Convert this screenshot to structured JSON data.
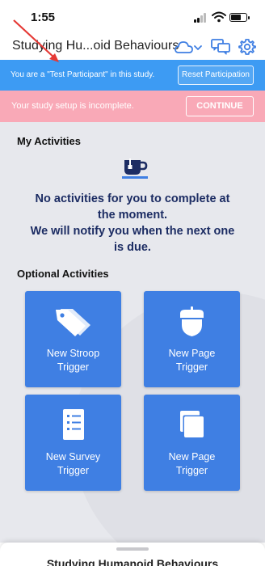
{
  "status_bar": {
    "time": "1:55",
    "battery_level": 0.7
  },
  "header": {
    "title": "Studying Hu...oid Behaviours",
    "icons": [
      "cloud-icon",
      "chevron-down-icon",
      "chat-icon",
      "gear-icon"
    ]
  },
  "test_banner": {
    "text": "You are a \"Test Participant\" in this study.",
    "button_label": "Reset Participation"
  },
  "setup_banner": {
    "text": "Your study setup is incomplete.",
    "button_label": "CONTINUE"
  },
  "activities": {
    "section_title": "My Activities",
    "empty_icon": "coffee-cup-icon",
    "empty_line1": "No activities for you to complete at",
    "empty_line2": "the moment.",
    "empty_line3": "We will notify you when the next one",
    "empty_line4": "is due."
  },
  "optional": {
    "section_title": "Optional Activities",
    "cards": [
      {
        "line1": "New Stroop",
        "line2": "Trigger",
        "icon": "tags-icon"
      },
      {
        "line1": "New Page",
        "line2": "Trigger",
        "icon": "acorn-icon"
      },
      {
        "line1": "New Survey",
        "line2": "Trigger",
        "icon": "survey-icon"
      },
      {
        "line1": "New Page",
        "line2": "Trigger",
        "icon": "pages-icon"
      }
    ]
  },
  "bottom_sheet": {
    "title": "Studying Humanoid Behaviours"
  },
  "colors": {
    "test_banner": "#3d9bf3",
    "setup_banner": "#f9a9b7",
    "card": "#3f7fe3",
    "empty_message": "#1c2c63",
    "annotation_arrow": "#e53935"
  }
}
